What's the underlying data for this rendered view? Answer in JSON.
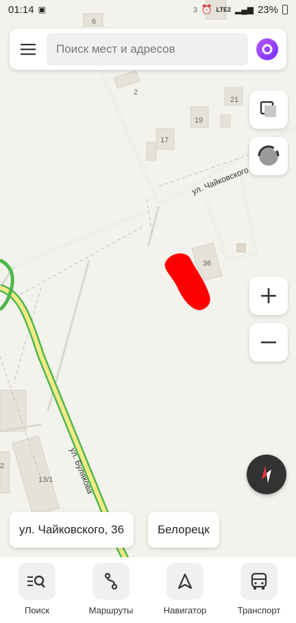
{
  "status_bar": {
    "time": "01:14",
    "battery": "23%",
    "network": "LTE2"
  },
  "search": {
    "placeholder": "Поиск мест и адресов"
  },
  "map": {
    "streets": {
      "chaikovskogo": "ул. Чайковского",
      "bulyakova": "ул. Булякова"
    },
    "houses": [
      "6",
      "2",
      "21",
      "19",
      "17",
      "36",
      "13/1",
      "3",
      "2"
    ],
    "marker_color": "#ff0000"
  },
  "chips": {
    "address": "ул. Чайковского, 36",
    "city": "Белорецк"
  },
  "bottom_nav": [
    {
      "label": "Поиск",
      "icon": "search-list-icon"
    },
    {
      "label": "Маршруты",
      "icon": "route-icon"
    },
    {
      "label": "Навигатор",
      "icon": "navigator-arrow-icon"
    },
    {
      "label": "Транспорт",
      "icon": "bus-icon"
    }
  ],
  "colors": {
    "accent": "#8a36ff",
    "road_green": "#4cb848",
    "road_yellow": "#f5e98a"
  }
}
